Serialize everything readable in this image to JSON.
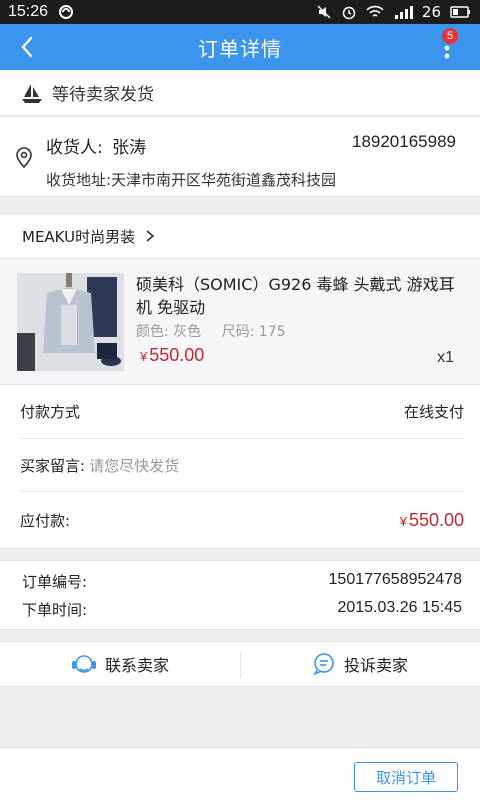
{
  "statusbar": {
    "time": "15:26",
    "battery": "26",
    "network": "3G"
  },
  "header": {
    "title": "订单详情",
    "badge": "5",
    "color": "#3b95ef"
  },
  "order_status": {
    "text": "等待卖家发货",
    "icon": "ship-icon"
  },
  "address": {
    "recipient_label": "收货人:",
    "recipient_name": "张涛",
    "phone": "18920165989",
    "address_line": "收货地址:天津市南开区华苑街道鑫茂科技园"
  },
  "store": {
    "name": "MEAKU时尚男装"
  },
  "product": {
    "name": "硕美科（SOMIC）G926 毒蜂 头戴式 游戏耳机 免驱动",
    "color_spec": "颜色: 灰色",
    "size_spec": "尺码: 175",
    "price_symbol": "¥",
    "price": "550.00",
    "quantity": "x1"
  },
  "payment": {
    "method_label": "付款方式",
    "method_value": "在线支付",
    "note_label": "买家留言:",
    "note_value": "请您尽快发货",
    "due_label": "应付款:",
    "due_symbol": "¥",
    "due_value": "550.00"
  },
  "order_info": {
    "number_label": "订单编号:",
    "number_value": "150177658952478",
    "time_label": "下单时间:",
    "time_value": "2015.03.26 15:45"
  },
  "contact": {
    "contact_seller": "联系卖家",
    "complain_seller": "投诉卖家"
  },
  "actions": {
    "cancel_order": "取消订单"
  },
  "colors": {
    "accent": "#3b95ef",
    "price": "#c6282d"
  }
}
